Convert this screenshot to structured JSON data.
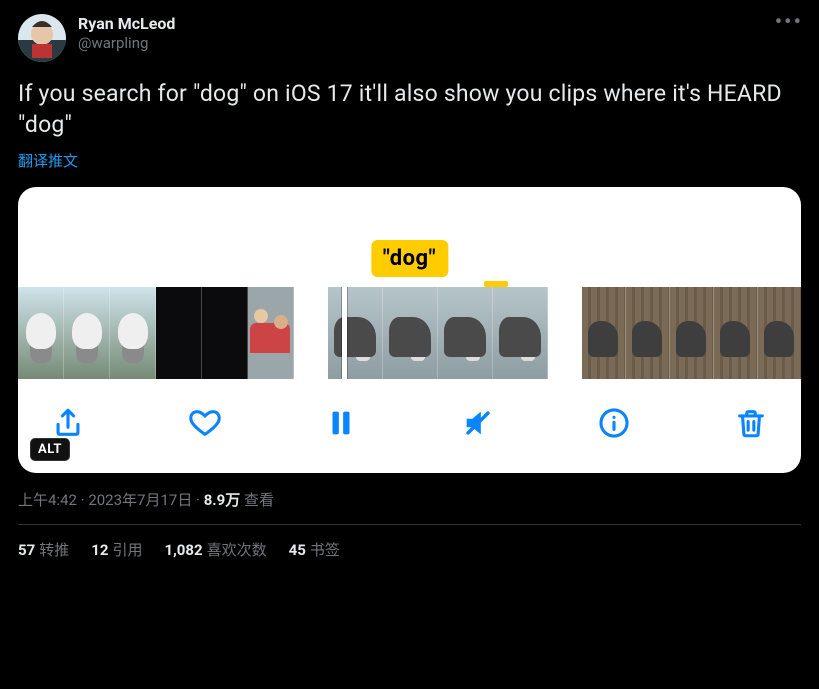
{
  "author": {
    "display_name": "Ryan McLeod",
    "handle": "@warpling"
  },
  "tweet_text": "If you search for \"dog\" on iOS 17 it'll also show you clips where it's HEARD \"dog\"",
  "translate_label": "翻译推文",
  "media": {
    "badge_text": "\"dog\"",
    "alt_badge": "ALT"
  },
  "meta": {
    "time": "上午4:42",
    "date": "2023年7月17日",
    "separator": " · ",
    "views_value": "8.9万",
    "views_label": " 查看"
  },
  "stats": {
    "retweets_value": "57",
    "retweets_label": "转推",
    "quotes_value": "12",
    "quotes_label": "引用",
    "likes_value": "1,082",
    "likes_label": "喜欢次数",
    "bookmarks_value": "45",
    "bookmarks_label": "书签"
  },
  "icons": {
    "share": "share-icon",
    "heart": "heart-icon",
    "pause": "pause-icon",
    "mute": "mute-icon",
    "info": "info-icon",
    "trash": "trash-icon"
  }
}
